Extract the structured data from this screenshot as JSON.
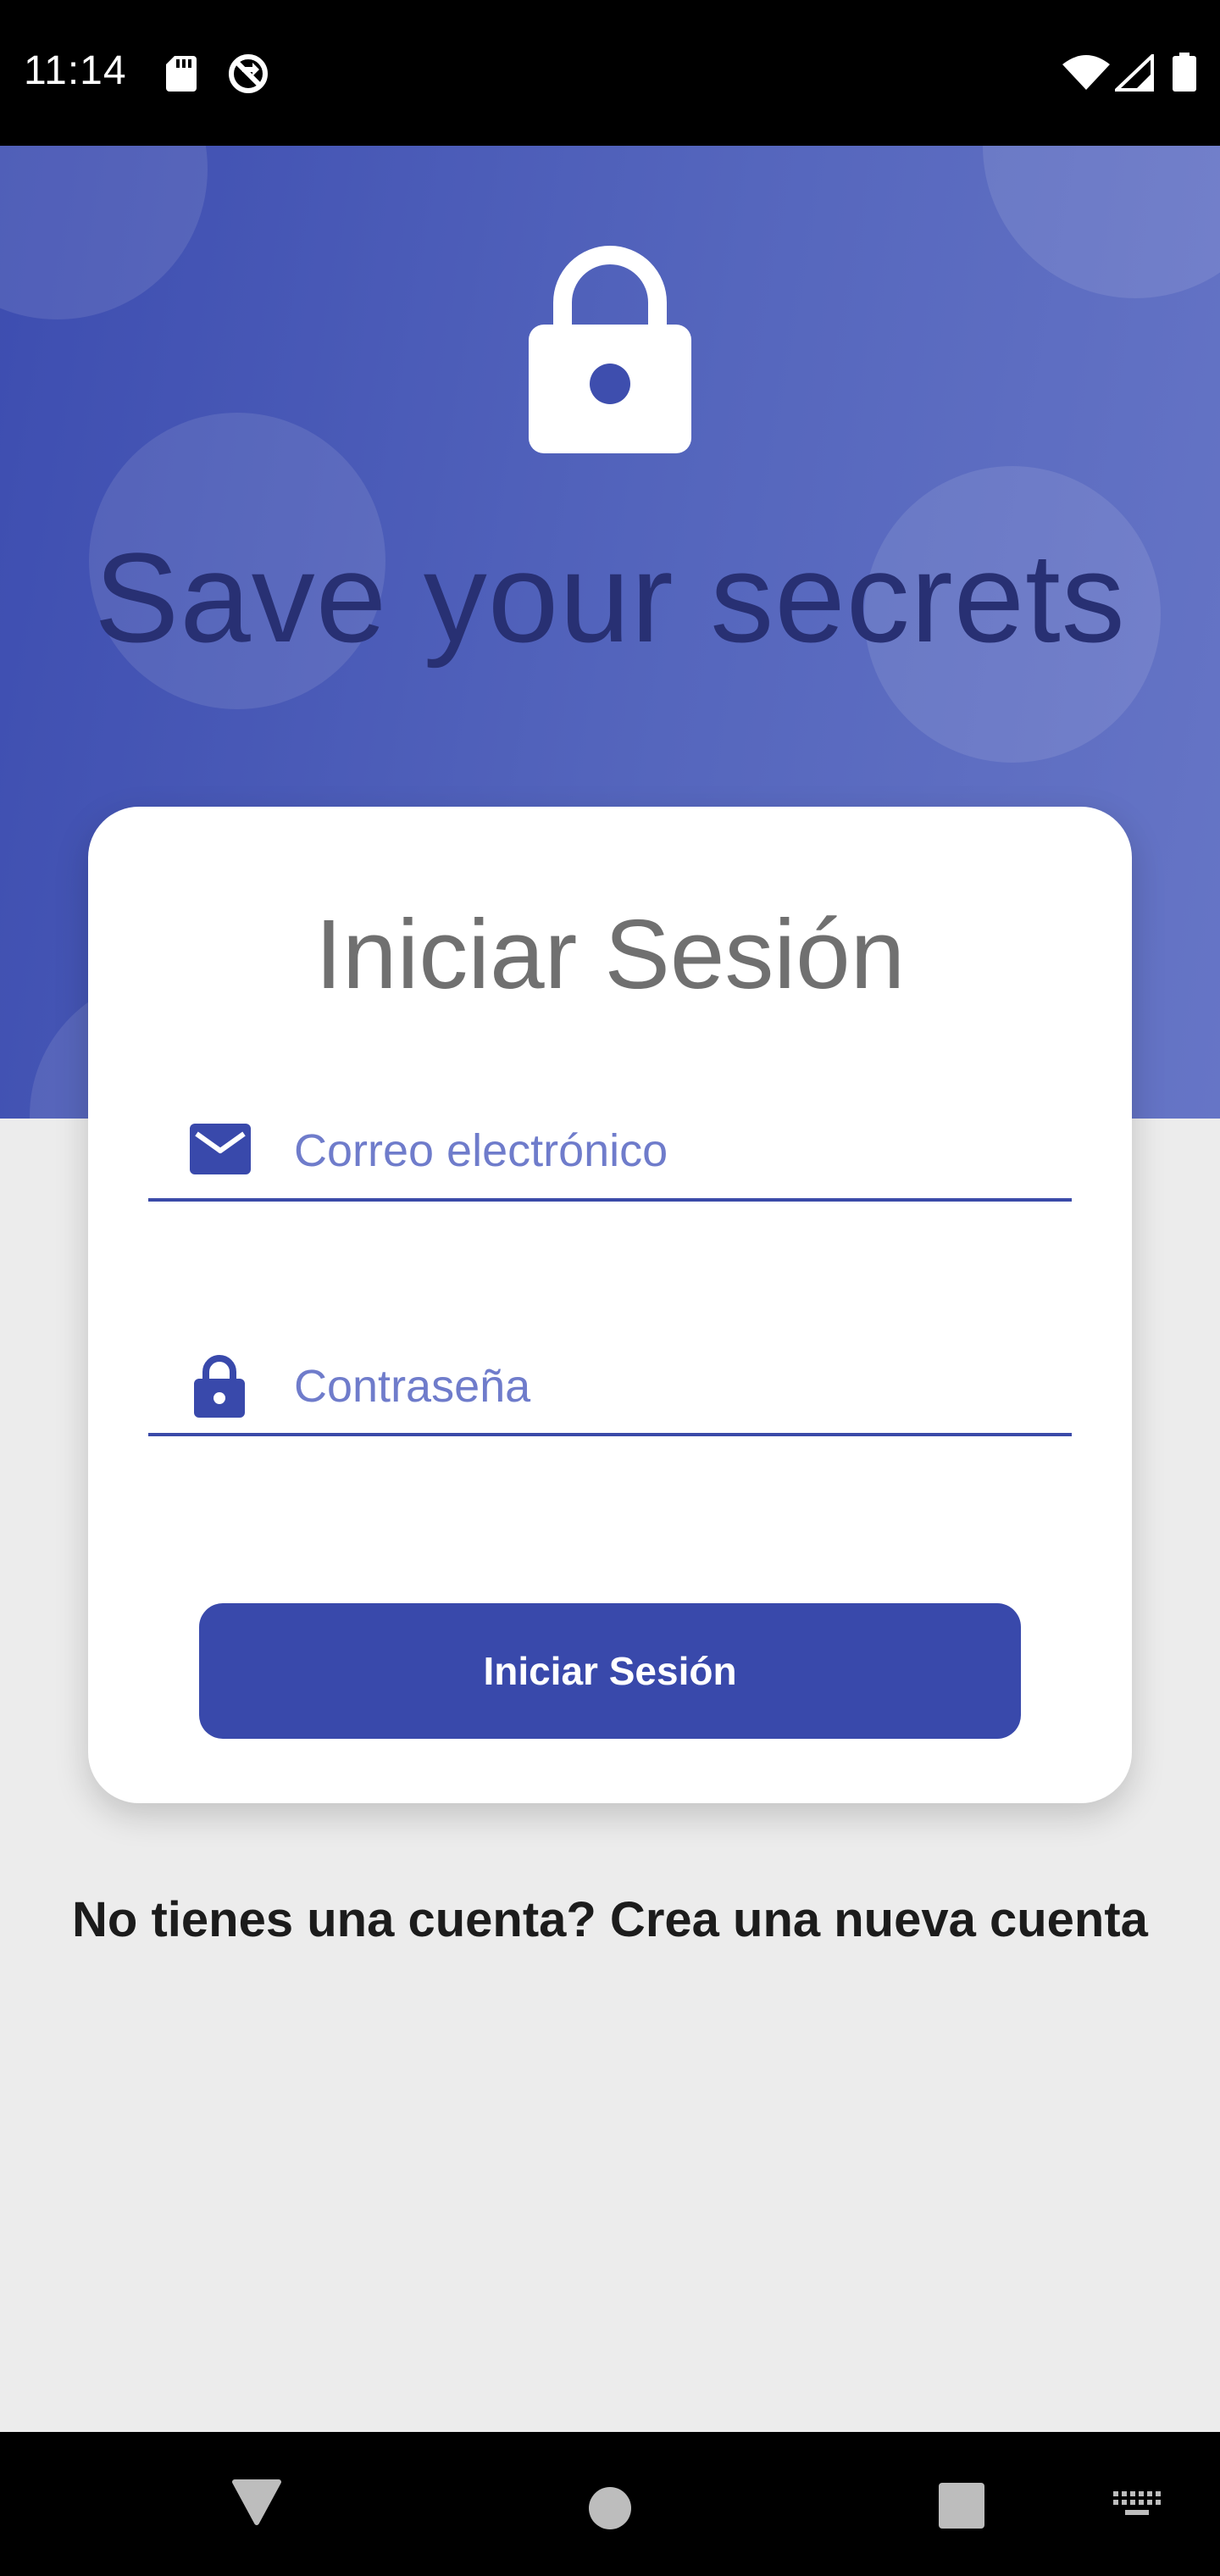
{
  "status_bar": {
    "time": "11:14",
    "icons": [
      "sd-card-icon",
      "sync-disabled-icon",
      "wifi-icon",
      "cell-signal-icon",
      "battery-icon"
    ]
  },
  "hero": {
    "icon": "lock-icon",
    "title": "Save your secrets"
  },
  "login_card": {
    "title": "Iniciar Sesión",
    "email": {
      "icon": "mail-icon",
      "placeholder": "Correo electrónico",
      "value": ""
    },
    "password": {
      "icon": "lock-icon",
      "placeholder": "Contraseña",
      "value": ""
    },
    "submit_label": "Iniciar Sesión"
  },
  "signup_prompt": "No tienes una cuenta? Crea una nueva cuenta",
  "nav_bar": {
    "icons": [
      "back-icon",
      "home-icon",
      "recents-icon",
      "keyboard-icon"
    ]
  },
  "colors": {
    "primary": "#3949ab",
    "hero_start": "#3d4db0",
    "hero_end": "#6675c6",
    "hint": "#6f7ccb",
    "title_dark": "#283073",
    "background": "#ececec"
  }
}
